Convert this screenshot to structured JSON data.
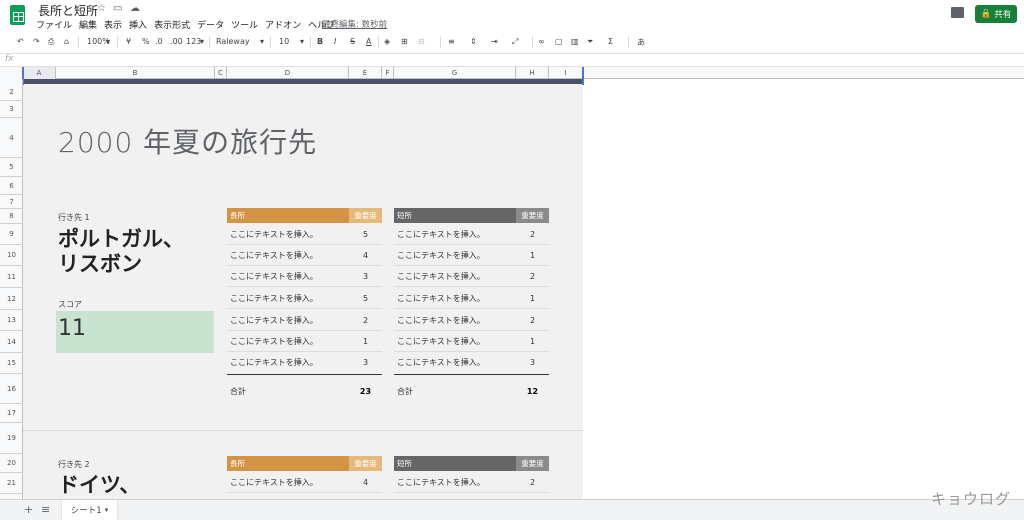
{
  "header": {
    "title": "長所と短所",
    "menu": [
      "ファイル",
      "編集",
      "表示",
      "挿入",
      "表示形式",
      "データ",
      "ツール",
      "アドオン",
      "ヘルプ"
    ],
    "last_edit": "最終編集: 数秒前",
    "share": "共有"
  },
  "toolbar": {
    "zoom": "100%",
    "currency": "¥",
    "percent": "%",
    "dec_minus": ".0",
    "dec_plus": ".00",
    "format": "123",
    "font": "Raleway",
    "size": "10",
    "bold": "B",
    "italic": "I",
    "strike": "S",
    "textcolor": "A",
    "input_tools": "あ"
  },
  "formula_bar": {
    "fx": "fx"
  },
  "columns": [
    "A",
    "B",
    "C",
    "D",
    "E",
    "F",
    "G",
    "H",
    "I"
  ],
  "rows": [
    "2",
    "3",
    "4",
    "5",
    "6",
    "7",
    "8",
    "9",
    "10",
    "11",
    "12",
    "13",
    "14",
    "15",
    "16",
    "17",
    "19",
    "20",
    "21"
  ],
  "sheet": {
    "main_title": "2000 年夏の旅行先",
    "dest1": {
      "label": "行き先 1",
      "name_line1": "ポルトガル、",
      "name_line2": "リスボン",
      "score_label": "スコア",
      "score": "11"
    },
    "dest2": {
      "label": "行き先 2",
      "name_line1": "ドイツ、"
    },
    "pros_header": "長所",
    "cons_header": "短所",
    "weight_header": "重要度",
    "placeholder": "ここにテキストを挿入。",
    "pros1": [
      "5",
      "4",
      "3",
      "5",
      "2",
      "1",
      "3"
    ],
    "cons1": [
      "2",
      "1",
      "2",
      "1",
      "2",
      "1",
      "3"
    ],
    "total_label": "合計",
    "pros1_total": "23",
    "cons1_total": "12",
    "pros2_first": "4",
    "cons2_first": "2"
  },
  "footer": {
    "sheet_tab": "シート1"
  },
  "watermark": "キョウログ",
  "colors": {
    "pros": "#d39545",
    "pros_weight": "#e6b97a",
    "cons": "#666666",
    "cons_weight": "#8a8a8a",
    "score_bg": "#c8e4d0"
  }
}
